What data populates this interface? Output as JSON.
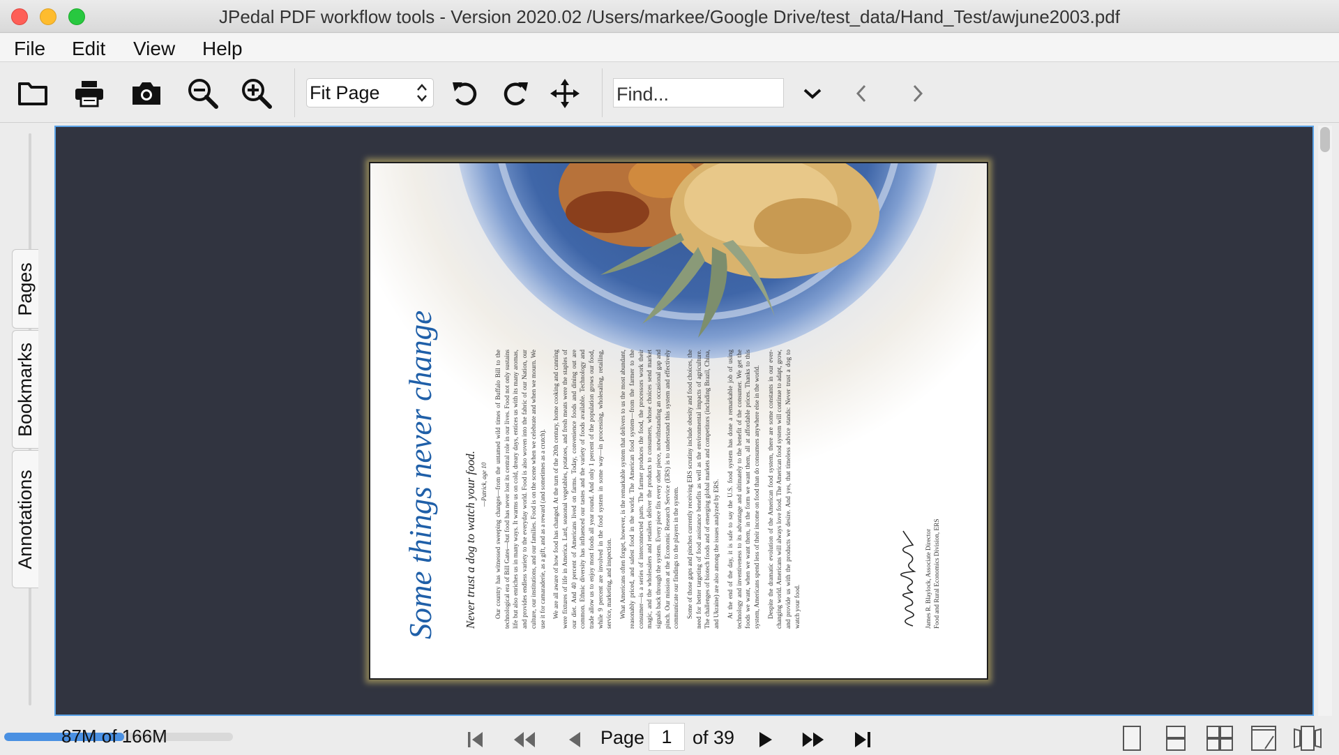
{
  "window": {
    "title": "JPedal PDF workflow tools - Version 2020.02 /Users/markee/Google Drive/test_data/Hand_Test/awjune2003.pdf"
  },
  "menu": [
    "File",
    "Edit",
    "View",
    "Help"
  ],
  "toolbar": {
    "icons": [
      "open-folder-icon",
      "print-icon",
      "snapshot-camera-icon",
      "zoom-out-icon",
      "zoom-in-icon",
      "rotate-left-icon",
      "rotate-right-icon",
      "pan-move-icon",
      "chevron-down-icon",
      "previous-result-icon",
      "next-result-icon"
    ],
    "zoom_mode": "Fit Page",
    "find_placeholder": "Find..."
  },
  "side_tabs": [
    "Pages",
    "Bookmarks",
    "Annotations"
  ],
  "document": {
    "headline": "Some things never change",
    "subhead": "Never trust a dog to watch your food.",
    "quote_attribution": "—Patrick, age 10",
    "paragraphs": [
      "Our country has witnessed sweeping changes—from the untamed wild times of Buffalo Bill to the technological era of Bill Gates—but food has never lost its central role in our lives. Food not only sustains life but also enriches us in many ways. It warms us on cold, dreary days, entices us with its many aromas, and provides endless variety to the everyday world. Food is also woven into the fabric of our Nation, our culture, our institutions, and our families. Food is on the scene when we celebrate and when we mourn. We use it for camaraderie, as a gift, and as a reward (and sometimes as a crutch).",
      "We are all aware of how food has changed. At the turn of the 20th century, home cooking and canning were fixtures of life in America. Lard, seasonal vegetables, potatoes, and fresh meats were the staples of our diet. And 40 percent of Americans lived on farms. Today, convenience foods and dining out are common. Ethnic diversity has influenced our tastes and the variety of foods available. Technology and trade allow us to enjoy most foods all year round. And only 1 percent of the population grows our food, while 9 percent are involved in the food system in some way—in processing, wholesaling, retailing, service, marketing, and inspection.",
      "What Americans often forget, however, is the remarkable system that delivers to us the most abundant, reasonably priced, and safest food in the world. The American food system—from the farmer to the consumer—is a series of interconnected parts. The farmer produces the food, the processors work their magic, and the wholesalers and retailers deliver the products to consumers, whose choices send market signals back through the system. Every piece fits every other piece, notwithstanding an occasional gap and pinch. Our mission at the Economic Research Service (ERS) is to understand this system and effectively communicate our findings to the players in the system.",
      "Some of those gaps and pinches currently receiving ERS scrutiny include obesity and food choices, the need for better targeting of food assistance benefits as well as the environmental impacts of agriculture. The challenges of biotech foods and of emerging global markets and competitors (including Brazil, China, and Ukraine) are also among the issues analyzed by ERS.",
      "At the end of the day, it is safe to say the U.S. food system has done a remarkable job of using technology and inventiveness to its advantage and ultimately to the benefit of the consumer. We get the foods we want, when we want them, in the form we want them, all at affordable prices. Thanks to this system, Americans spend less of their income on food than do consumers anywhere else in the world.",
      "Despite the dramatic evolution of the American food system, there are some constants in our ever-changing world. Americans will always love food. The American food system will continue to adapt, grow, and provide us with the products we desire. And yes, that timeless advice stands: Never trust a dog to watch your food."
    ],
    "signature": "James Blaylock",
    "signer_lines": [
      "James R. Blaylock, Associate Director",
      "Food and Rural Economics Division, ERS"
    ]
  },
  "status": {
    "memory": "87M of 166M",
    "memory_used_fraction": 0.524
  },
  "navigation": {
    "page_label": "Page",
    "current_page": "1",
    "page_count_label": "of 39",
    "icons": [
      "first-page-icon",
      "back-10-pages-icon",
      "previous-page-icon",
      "next-page-icon",
      "forward-10-pages-icon",
      "last-page-icon"
    ]
  },
  "view_modes": [
    "single-page-view-icon",
    "continuous-view-icon",
    "facing-pages-view-icon",
    "continuous-facing-view-icon",
    "page-flow-view-icon"
  ],
  "colors": {
    "viewer_background": "#313440",
    "focus_border": "#5aa3e8",
    "headline": "#1f5fa8",
    "memory_bar": "#4a90e2"
  }
}
